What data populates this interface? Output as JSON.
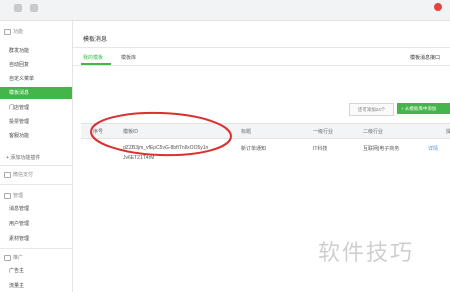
{
  "sidebar": {
    "sections": [
      {
        "label": "功能"
      },
      {
        "label": "微信支付"
      },
      {
        "label": "管理"
      },
      {
        "label": "推广"
      }
    ],
    "items": [
      {
        "label": "群发功能"
      },
      {
        "label": "自动回复"
      },
      {
        "label": "自定义菜单"
      },
      {
        "label": "模板消息"
      },
      {
        "label": "门店管理"
      },
      {
        "label": "投票管理"
      },
      {
        "label": "客服功能"
      },
      {
        "label": "消息管理"
      },
      {
        "label": "用户管理"
      },
      {
        "label": "素材管理"
      },
      {
        "label": "广告主"
      },
      {
        "label": "流量主"
      }
    ],
    "add_function": "+ 添加功能插件"
  },
  "main": {
    "title": "模板消息",
    "tabs": [
      {
        "label": "我的模板"
      },
      {
        "label": "模板库"
      }
    ],
    "right_link": "模板消息接口",
    "count_button": "还可添加24个",
    "add_button": "+ 从模板库中添加",
    "table": {
      "headers": [
        "序号",
        "模板ID",
        "标题",
        "一级行业",
        "二级行业",
        "操"
      ],
      "rows": [
        {
          "id_line1": "dZZB3jm_vfEpC5vG-8bftTnIlxOO5y1n",
          "id_line2": "Jv6ET21T4rM",
          "title": "新订单通知",
          "industry1": "IT科技",
          "industry2": "互联网|电子商务",
          "action": "详情"
        }
      ]
    }
  },
  "watermark": "软件技巧",
  "colors": {
    "accent": "#44b549",
    "link": "#459ae9",
    "annotation": "#d93030"
  }
}
